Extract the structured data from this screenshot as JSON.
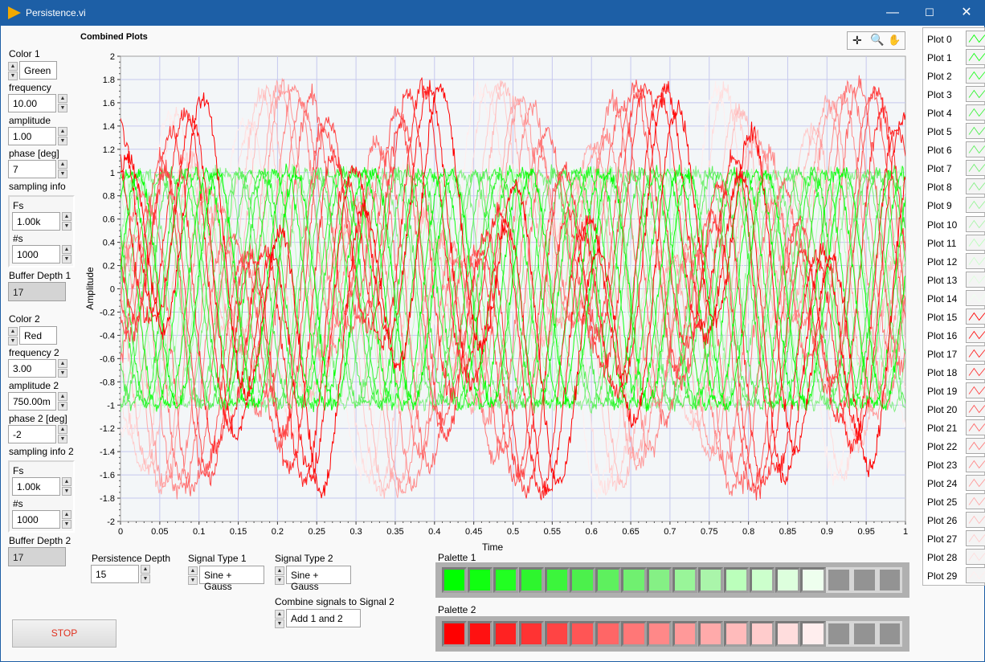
{
  "window": {
    "title": "Persistence.vi",
    "minimize": "—",
    "maximize": "☐",
    "close": "✕"
  },
  "controls1": {
    "color_label": "Color 1",
    "color": "Green",
    "frequency_label": "frequency",
    "frequency": "10.00",
    "amplitude_label": "amplitude",
    "amplitude": "1.00",
    "phase_label": "phase [deg]",
    "phase": "7",
    "sampling_label": "sampling info",
    "fs_label": "Fs",
    "fs": "1.00k",
    "ns_label": "#s",
    "ns": "1000",
    "buffer_label": "Buffer Depth 1",
    "buffer": "17"
  },
  "controls2": {
    "color_label": "Color 2",
    "color": "Red",
    "frequency_label": "frequency 2",
    "frequency": "3.00",
    "amplitude_label": "amplitude 2",
    "amplitude": "750.00m",
    "phase_label": "phase 2 [deg]",
    "phase": "-2",
    "sampling_label": "sampling info 2",
    "fs_label": "Fs",
    "fs": "1.00k",
    "ns_label": "#s",
    "ns": "1000",
    "buffer_label": "Buffer Depth 2",
    "buffer": "17"
  },
  "stop_label": "STOP",
  "persistence": {
    "label": "Persistence Depth",
    "value": "15"
  },
  "signal_type1": {
    "label": "Signal Type 1",
    "value": "Sine + Gauss"
  },
  "signal_type2": {
    "label": "Signal Type 2",
    "value": "Sine + Gauss"
  },
  "combine": {
    "label": "Combine signals to Signal 2",
    "value": "Add 1 and 2"
  },
  "palette1": {
    "label": "Palette 1",
    "colors": [
      "#00ff00",
      "#11ff11",
      "#22ff22",
      "#2ef52e",
      "#3cf53c",
      "#4cf04c",
      "#5ef05e",
      "#70f070",
      "#85f085",
      "#99f599",
      "#aaf5aa",
      "#bbffbb",
      "#ccffcc",
      "#ddffdd",
      "#eeffee"
    ],
    "empty_slots": 3
  },
  "palette2": {
    "label": "Palette 2",
    "colors": [
      "#ff0000",
      "#ff1111",
      "#ff2222",
      "#ff3333",
      "#ff4444",
      "#ff5555",
      "#ff6666",
      "#ff7777",
      "#ff8888",
      "#ff9999",
      "#ffaaaa",
      "#ffbbbb",
      "#ffcccc",
      "#ffdddd",
      "#ffeeee"
    ],
    "empty_slots": 3
  },
  "graph": {
    "title": "Combined Plots",
    "xlabel": "Time",
    "ylabel": "Amplitude",
    "xlim": [
      0,
      1
    ],
    "ylim": [
      -2,
      2
    ],
    "xticks": [
      "0",
      "0.05",
      "0.1",
      "0.15",
      "0.2",
      "0.25",
      "0.3",
      "0.35",
      "0.4",
      "0.45",
      "0.5",
      "0.55",
      "0.6",
      "0.65",
      "0.7",
      "0.75",
      "0.8",
      "0.85",
      "0.9",
      "0.95",
      "1"
    ],
    "yticks": [
      "2",
      "1.8",
      "1.6",
      "1.4",
      "1.2",
      "1",
      "0.8",
      "0.6",
      "0.4",
      "0.2",
      "0",
      "-0.2",
      "-0.4",
      "-0.6",
      "-0.8",
      "-1",
      "-1.2",
      "-1.4",
      "-1.6",
      "-1.8",
      "-2"
    ],
    "grid": true,
    "background": "#f3f6f8",
    "grid_color": "#c6c8ee",
    "tools": [
      "cursor-icon",
      "zoom-icon",
      "pan-icon"
    ]
  },
  "legend": [
    "Plot 0",
    "Plot 1",
    "Plot 2",
    "Plot 3",
    "Plot 4",
    "Plot 5",
    "Plot 6",
    "Plot 7",
    "Plot 8",
    "Plot 9",
    "Plot 10",
    "Plot 11",
    "Plot 12",
    "Plot 13",
    "Plot 14",
    "Plot 15",
    "Plot 16",
    "Plot 17",
    "Plot 18",
    "Plot 19",
    "Plot 20",
    "Plot 21",
    "Plot 22",
    "Plot 23",
    "Plot 24",
    "Plot 25",
    "Plot 26",
    "Plot 27",
    "Plot 28",
    "Plot 29"
  ]
}
